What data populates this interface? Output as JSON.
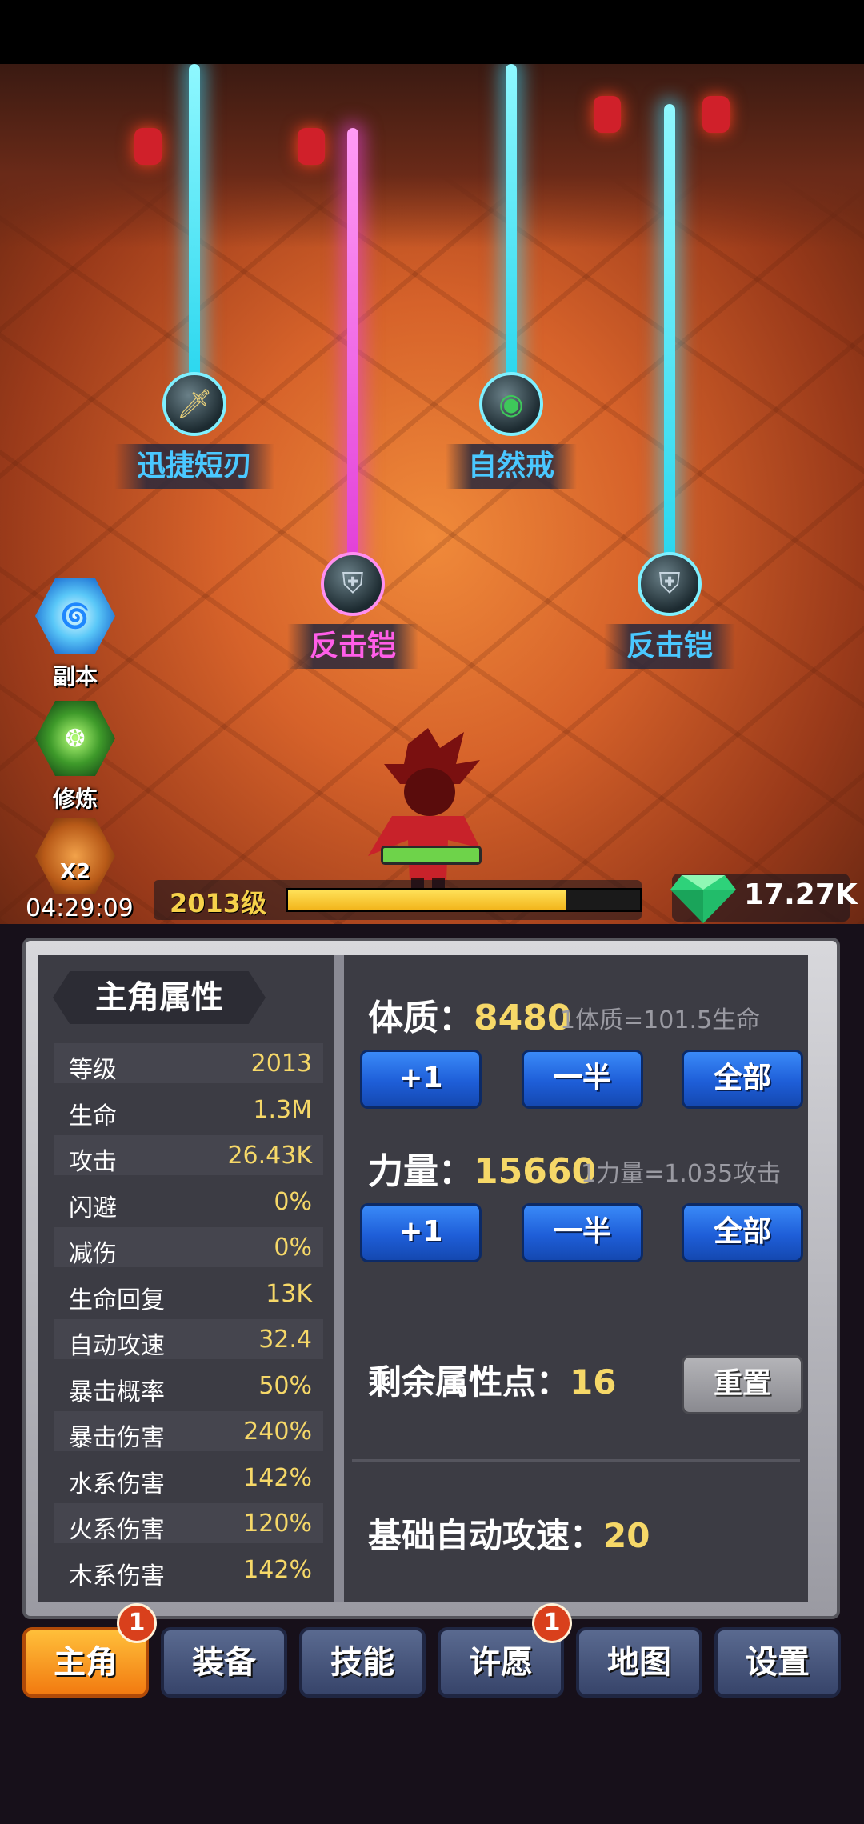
{
  "scene": {
    "drops": [
      {
        "label": "迅捷短刃",
        "color": "cyan",
        "icon": "dagger-icon"
      },
      {
        "label": "自然戒",
        "color": "cyan",
        "icon": "ring-icon"
      },
      {
        "label": "反击铠",
        "color": "pink",
        "icon": "armor-icon"
      },
      {
        "label": "反击铠",
        "color": "cyan",
        "icon": "armor-icon"
      }
    ],
    "side_buttons": [
      {
        "label": "副本",
        "icon": "dungeon-portal-icon"
      },
      {
        "label": "修炼",
        "icon": "training-icon"
      }
    ],
    "boost": {
      "badge": "X2",
      "timer": "04:29:09",
      "icon": "double-boost-icon"
    },
    "level_label": "2013级",
    "xp_progress_fraction": 0.79,
    "gems": "17.27K",
    "hero_hp_fraction": 1.0
  },
  "attributes": {
    "title": "主角属性",
    "stats": [
      {
        "name": "等级",
        "value": "2013"
      },
      {
        "name": "生命",
        "value": "1.3M"
      },
      {
        "name": "攻击",
        "value": "26.43K"
      },
      {
        "name": "闪避",
        "value": "0%"
      },
      {
        "name": "减伤",
        "value": "0%"
      },
      {
        "name": "生命回复",
        "value": "13K"
      },
      {
        "name": "自动攻速",
        "value": "32.4"
      },
      {
        "name": "暴击概率",
        "value": "50%"
      },
      {
        "name": "暴击伤害",
        "value": "240%"
      },
      {
        "name": "水系伤害",
        "value": "142%"
      },
      {
        "name": "火系伤害",
        "value": "120%"
      },
      {
        "name": "木系伤害",
        "value": "142%"
      }
    ]
  },
  "allocation": {
    "constitution": {
      "label": "体质：",
      "value": "8480",
      "hint": "1体质=101.5生命"
    },
    "strength": {
      "label": "力量：",
      "value": "15660",
      "hint": "1力量=1.035攻击"
    },
    "buttons": {
      "plus_one": "+1",
      "half": "一半",
      "all": "全部"
    },
    "remaining": {
      "label": "剩余属性点：",
      "value": "16"
    },
    "reset_label": "重置",
    "base_speed": {
      "label": "基础自动攻速：",
      "value": "20"
    }
  },
  "tabs": [
    {
      "label": "主角",
      "active": true,
      "badge": "1"
    },
    {
      "label": "装备",
      "active": false,
      "badge": ""
    },
    {
      "label": "技能",
      "active": false,
      "badge": ""
    },
    {
      "label": "许愿",
      "active": false,
      "badge": "1"
    },
    {
      "label": "地图",
      "active": false,
      "badge": ""
    },
    {
      "label": "设置",
      "active": false,
      "badge": ""
    }
  ],
  "colors": {
    "beam_cyan": "#29d6ee",
    "beam_pink": "#e23fd8",
    "accent_gold": "#f6d868",
    "tab_active": "#f27a10"
  }
}
